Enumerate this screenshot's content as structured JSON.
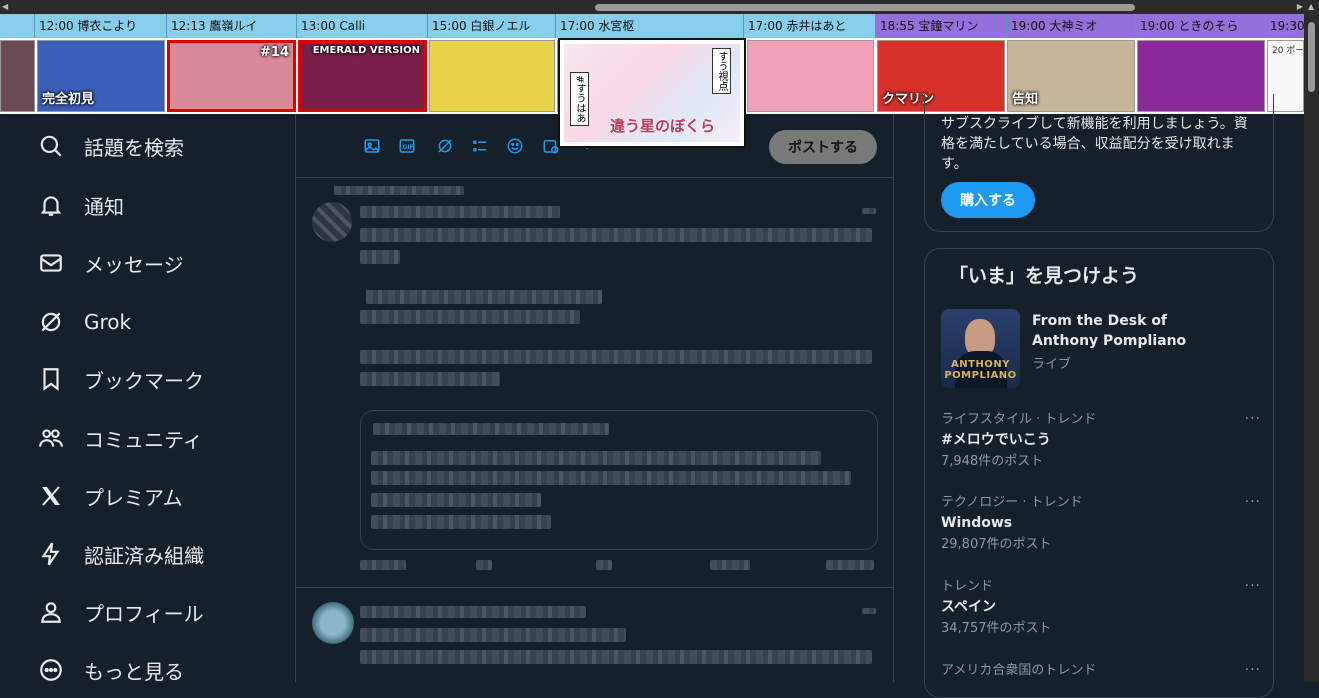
{
  "schedule": {
    "slots": [
      {
        "label": "12:00  博衣こより",
        "purple": false
      },
      {
        "label": "12:13  鷹嶺ルイ",
        "purple": false
      },
      {
        "label": "13:00  Calli",
        "purple": false
      },
      {
        "label": "15:00  白銀ノエル",
        "purple": false
      },
      {
        "label": "17:00  水宮枢",
        "purple": false
      },
      {
        "label": "17:00  赤井はあと",
        "purple": false
      },
      {
        "label": "18:55  宝鐘マリン",
        "purple": true
      },
      {
        "label": "19:00  大神ミオ",
        "purple": true
      },
      {
        "label": "19:00  ときのそら",
        "purple": true
      },
      {
        "label": "19:30",
        "purple": true
      }
    ],
    "thumbs": [
      {
        "caption": "",
        "color": "#6a4a55"
      },
      {
        "caption": "完全初見",
        "color": "#3a5fb8"
      },
      {
        "caption": "#14",
        "color": "#d98a9a"
      },
      {
        "caption": "EMERALD VERSION",
        "color": "#7a1e4a"
      },
      {
        "caption": "",
        "color": "#e8d24a"
      },
      {
        "caption": "",
        "color": "#e9b8c8"
      },
      {
        "caption": "",
        "color": "#f0a0b8"
      },
      {
        "caption": "クマリン",
        "color": "#d8302a"
      },
      {
        "caption": "告知",
        "color": "#c7b59a"
      },
      {
        "caption": "",
        "color": "#8a2a9a"
      },
      {
        "caption": "20 ポー",
        "color": "#f8f8f8"
      }
    ],
    "popup": {
      "caption": "違う星のぼくら",
      "vlabel_left": "#すうはあ",
      "vlabel_right": "すう視点"
    }
  },
  "nav": {
    "items": [
      {
        "label": "話題を検索",
        "icon": "search-icon"
      },
      {
        "label": "通知",
        "icon": "bell-icon"
      },
      {
        "label": "メッセージ",
        "icon": "envelope-icon"
      },
      {
        "label": "Grok",
        "icon": "grok-icon"
      },
      {
        "label": "ブックマーク",
        "icon": "bookmark-icon"
      },
      {
        "label": "コミュニティ",
        "icon": "community-icon"
      },
      {
        "label": "プレミアム",
        "icon": "x-logo-icon"
      },
      {
        "label": "認証済み組織",
        "icon": "lightning-icon"
      },
      {
        "label": "プロフィール",
        "icon": "person-icon"
      },
      {
        "label": "もっと見る",
        "icon": "more-circle-icon"
      }
    ]
  },
  "composer": {
    "post_label": "ポストする",
    "tools": [
      "image-icon",
      "gif-icon",
      "grok-icon",
      "poll-icon",
      "emoji-icon",
      "schedule-icon",
      "location-icon"
    ]
  },
  "premium": {
    "text": "サブスクライブして新機能を利用しましょう。資格を満たしている場合、収益配分を受け取れます。",
    "buy_label": "購入する"
  },
  "trends": {
    "title": "「いま」を見つけよう",
    "live": {
      "title": "From the Desk of Anthony Pompliano",
      "sub": "ライブ",
      "image_brand": "ANTHONY POMPLIANO"
    },
    "items": [
      {
        "category": "ライフスタイル · トレンド",
        "name": "#メロウでいこう",
        "count": "7,948件のポスト"
      },
      {
        "category": "テクノロジー · トレンド",
        "name": "Windows",
        "count": "29,807件のポスト"
      },
      {
        "category": "トレンド",
        "name": "スペイン",
        "count": "34,757件のポスト"
      },
      {
        "category": "アメリカ合衆国のトレンド",
        "name": "",
        "count": ""
      }
    ],
    "more_label": "···"
  },
  "colors": {
    "background": "#15202b",
    "accent": "#1d9bf0",
    "timebar": "#87ceeb",
    "timebar_evening": "#9370db",
    "live_border": "#e00000"
  }
}
